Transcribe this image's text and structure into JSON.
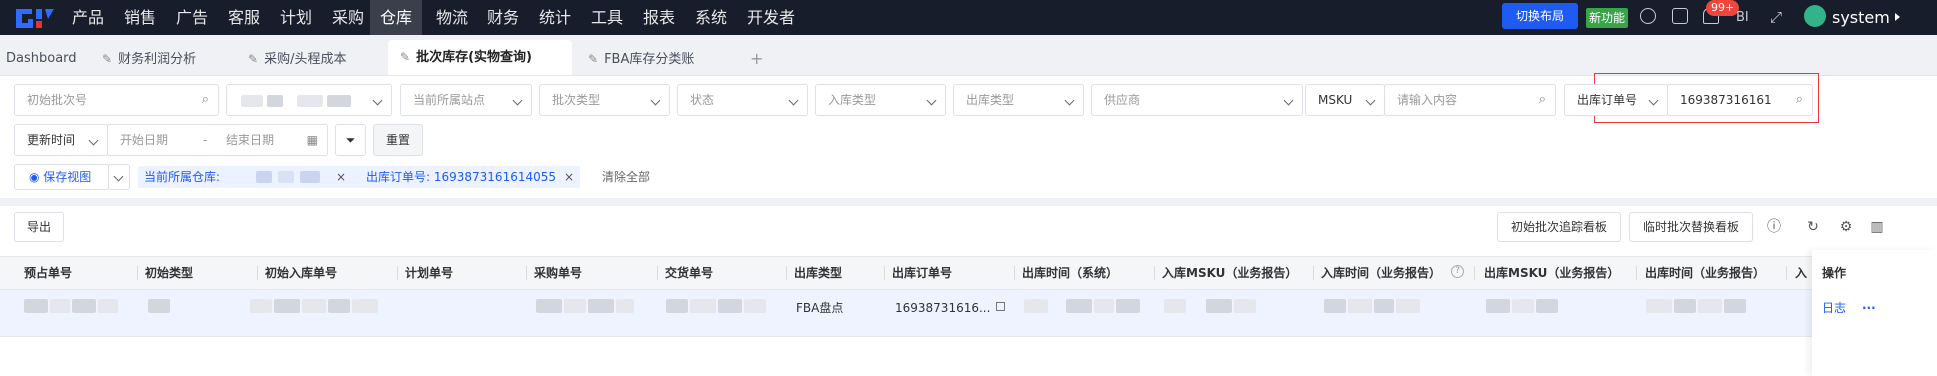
{
  "topnav": {
    "items": [
      "产品",
      "销售",
      "广告",
      "客服",
      "计划",
      "采购",
      "仓库",
      "物流",
      "财务",
      "统计",
      "工具",
      "报表",
      "系统",
      "开发者"
    ],
    "active": "仓库",
    "switch_layout": "切换布局",
    "new_feature": "新功能",
    "notif_count": "99+",
    "extra_icon_text": "BI",
    "user": "system"
  },
  "tabs": {
    "items": [
      "Dashboard",
      "财务利润分析",
      "采购/头程成本",
      "批次库存(实物查询)",
      "FBA库存分类账"
    ],
    "add": "+"
  },
  "filters": {
    "initial_batch_placeholder": "初始批次号",
    "current_site_placeholder": "当前所属站点",
    "batch_type_placeholder": "批次类型",
    "status_placeholder": "状态",
    "in_type_placeholder": "入库类型",
    "out_type_placeholder": "出库类型",
    "supplier_placeholder": "供应商",
    "msku_label": "MSKU",
    "search_content_placeholder": "请输入内容",
    "out_order_label": "出库订单号",
    "out_order_value": "169387316161",
    "time_select": "更新时间",
    "start_date": "开始日期",
    "date_sep": "-",
    "end_date": "结束日期",
    "reset": "重置"
  },
  "view": {
    "save_view": "保存视图",
    "tag_warehouse": "当前所属仓库:",
    "tag_out_order": "出库订单号: 1693873161614055",
    "clear_all": "清除全部"
  },
  "toolbar": {
    "export": "导出",
    "initial_batch_board": "初始批次追踪看板",
    "temp_batch_board": "临时批次替换看板"
  },
  "table": {
    "columns": [
      "预占单号",
      "初始类型",
      "初始入库单号",
      "计划单号",
      "采购单号",
      "交货单号",
      "出库类型",
      "出库订单号",
      "出库时间（系统）",
      "入库MSKU（业务报告）",
      "入库时间（业务报告）",
      "出库MSKU（业务报告）",
      "出库时间（业务报告）",
      "入",
      "操作"
    ],
    "row": {
      "out_type": "FBA盘点",
      "out_order": "16938731616...",
      "log": "日志",
      "more": "···"
    }
  },
  "colors": {
    "topbar": "#181d2b",
    "accent": "#1d5bf2",
    "highlight_border": "#e33b3b",
    "new_badge": "#3aa34a"
  }
}
